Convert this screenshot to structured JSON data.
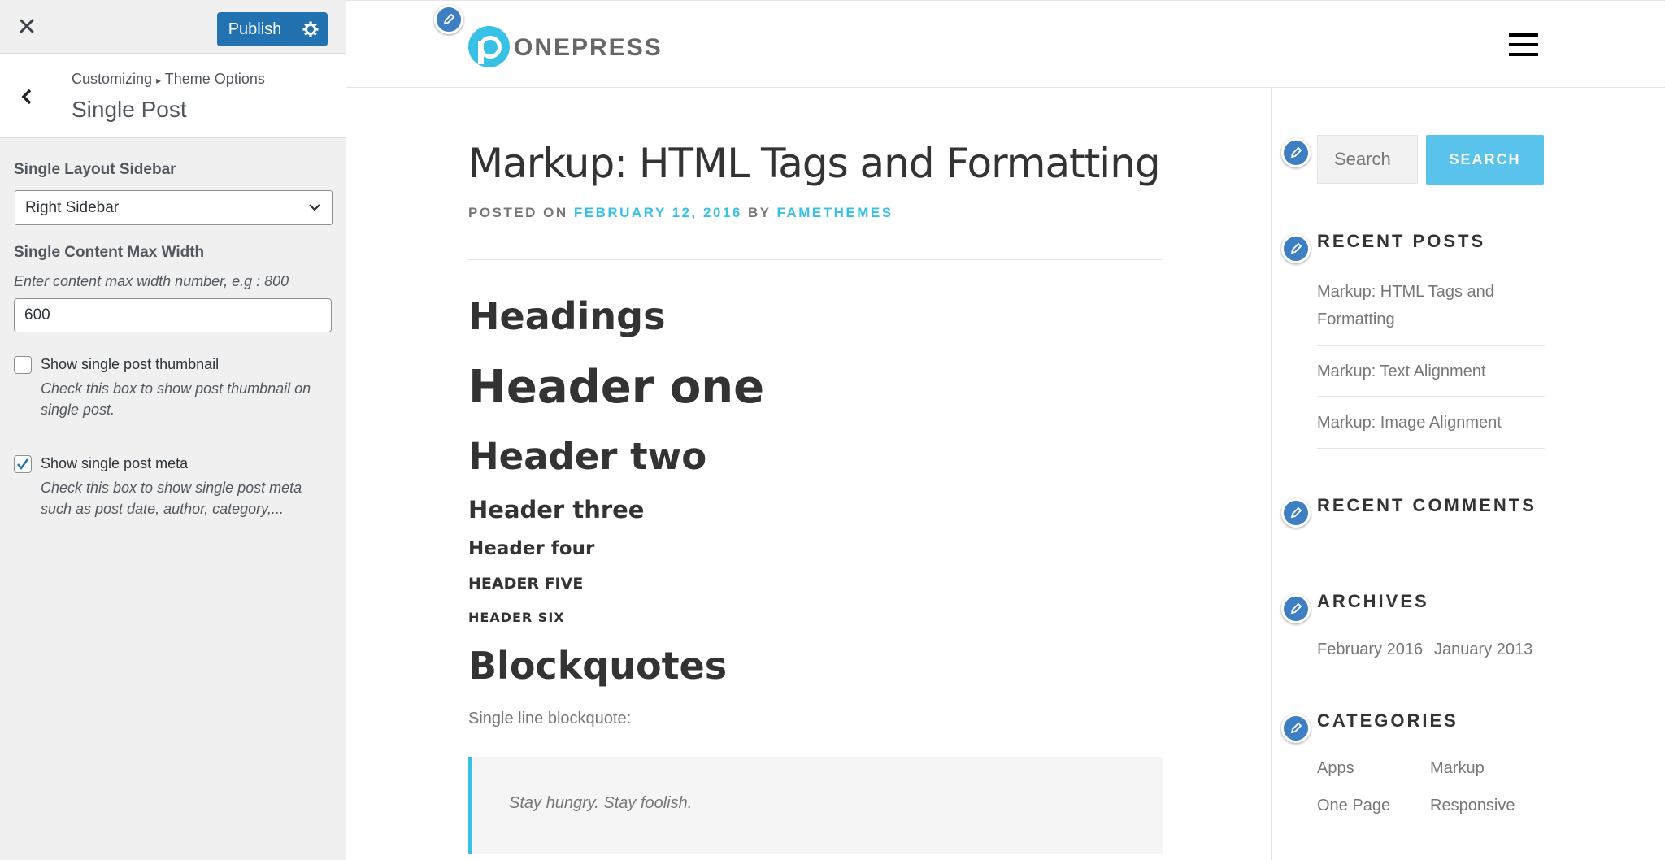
{
  "customizer": {
    "close_glyph": "✕",
    "publish_label": "Publish",
    "breadcrumb_prefix": "Customizing",
    "breadcrumb_sep": "▸",
    "breadcrumb_parent": "Theme Options",
    "section_title": "Single Post",
    "layout_label": "Single Layout Sidebar",
    "layout_value": "Right Sidebar",
    "width_label": "Single Content Max Width",
    "width_desc": "Enter content max width number, e.g : 800",
    "width_value": "600",
    "thumb_label": "Show single post thumbnail",
    "thumb_desc": "Check this box to show post thumbnail on single post.",
    "thumb_checked": false,
    "meta_label": "Show single post meta",
    "meta_desc": "Check this box to show single post meta such as post date, author, category,...",
    "meta_checked": true
  },
  "site": {
    "logo_text": "ONEPRESS",
    "brand_color": "#38c0e6"
  },
  "post": {
    "title": "Markup: HTML Tags and Formatting",
    "meta_posted_on": "POSTED ON",
    "meta_date": "FEBRUARY 12, 2016",
    "meta_by": "BY",
    "meta_author": "FAMETHEMES",
    "headings_title": "Headings",
    "h1": "Header one",
    "h2": "Header two",
    "h3": "Header three",
    "h4": "Header four",
    "h5": "HEADER FIVE",
    "h6": "HEADER SIX",
    "blockquotes_title": "Blockquotes",
    "quote_intro": "Single line blockquote:",
    "quote_text": "Stay hungry. Stay foolish."
  },
  "sidebar": {
    "search_placeholder": "Search",
    "search_button": "SEARCH",
    "recent_posts_title": "RECENT POSTS",
    "recent_posts": [
      "Markup: HTML Tags and Formatting",
      "Markup: Text Alignment",
      "Markup: Image Alignment"
    ],
    "recent_comments_title": "RECENT COMMENTS",
    "archives_title": "ARCHIVES",
    "archives": [
      "February 2016",
      "January 2013"
    ],
    "categories_title": "CATEGORIES",
    "categories": [
      "Apps",
      "Markup",
      "One Page",
      "Responsive"
    ]
  }
}
